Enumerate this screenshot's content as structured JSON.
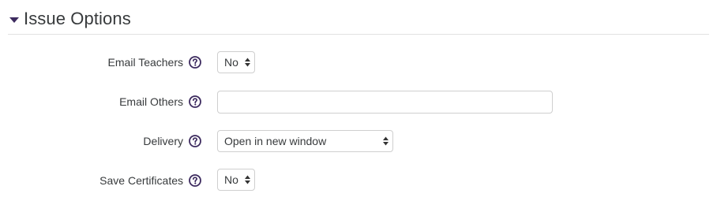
{
  "section": {
    "title": "Issue Options",
    "icon": "caret-down-icon",
    "accent_color": "#3d2b5f"
  },
  "fields": {
    "email_teachers": {
      "label": "Email Teachers",
      "help_icon": "question-circle-icon",
      "value": "No"
    },
    "email_others": {
      "label": "Email Others",
      "help_icon": "question-circle-icon",
      "value": "",
      "placeholder": ""
    },
    "delivery": {
      "label": "Delivery",
      "help_icon": "question-circle-icon",
      "value": "Open in new window"
    },
    "save_certificates": {
      "label": "Save Certificates",
      "help_icon": "question-circle-icon",
      "value": "No"
    }
  }
}
